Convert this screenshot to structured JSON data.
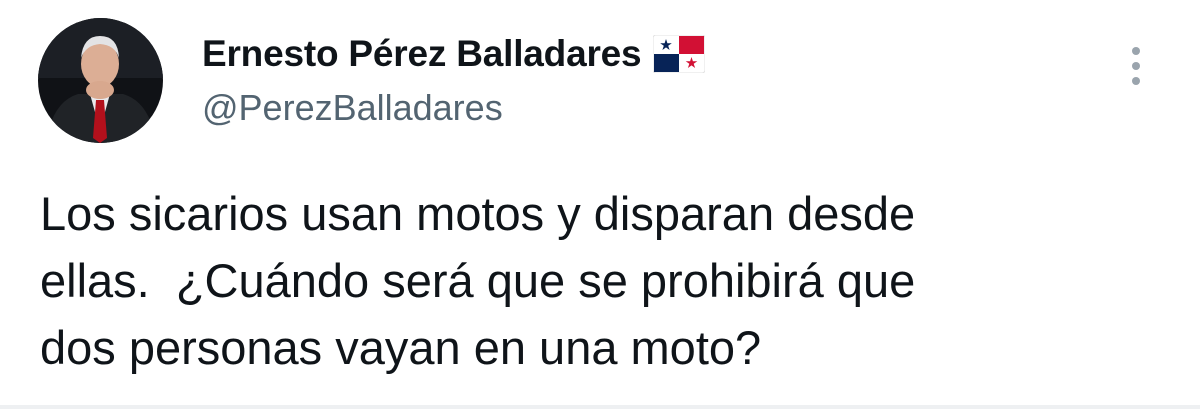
{
  "author": {
    "display_name": "Ernesto Pérez Balladares",
    "handle": "@PerezBalladares",
    "flag_emoji": "panama-flag"
  },
  "tweet": {
    "text": "Los sicarios usan motos y disparan desde\nellas.  ¿Cuándo será que se prohibirá que\ndos personas vayan en una moto?"
  },
  "icons": {
    "avatar": "profile-photo",
    "more": "more-vertical-icon"
  },
  "colors": {
    "text_primary": "#0f1419",
    "text_secondary": "#536471",
    "flag_red": "#d21034",
    "flag_blue": "#072357"
  }
}
